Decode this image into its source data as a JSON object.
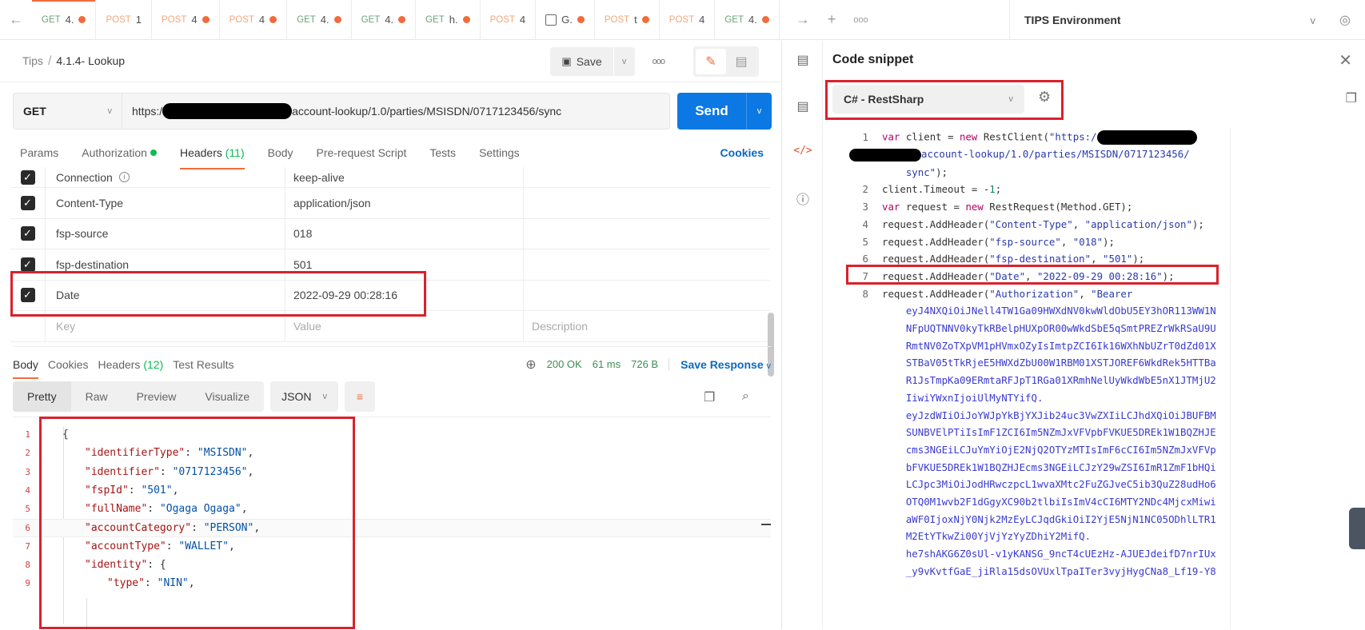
{
  "tabbar": {
    "tabs": [
      {
        "method": "GET",
        "name": "4.",
        "unsaved": true,
        "active": true
      },
      {
        "method": "POST",
        "name": "1",
        "unsaved": false
      },
      {
        "method": "POST",
        "name": "4",
        "unsaved": true
      },
      {
        "method": "POST",
        "name": "4",
        "unsaved": true
      },
      {
        "method": "GET",
        "name": "4.",
        "unsaved": true
      },
      {
        "method": "GET",
        "name": "4.",
        "unsaved": true
      },
      {
        "method": "GET",
        "name": "h.",
        "unsaved": true
      },
      {
        "method": "POST",
        "name": "4",
        "unsaved": false
      },
      {
        "method": "",
        "name": "G.",
        "unsaved": true,
        "icon": "example-icon"
      },
      {
        "method": "POST",
        "name": "t",
        "unsaved": true
      },
      {
        "method": "POST",
        "name": "4",
        "unsaved": false
      },
      {
        "method": "GET",
        "name": "4.",
        "unsaved": true
      }
    ],
    "environment": "TIPS Environment"
  },
  "request": {
    "breadcrumb_root": "Tips",
    "breadcrumb_sep": "/",
    "title": "4.1.4- Lookup",
    "save_label": "Save",
    "method": "GET",
    "url_prefix": "https:/",
    "url_suffix": "account-lookup/1.0/parties/MSISDN/0717123456/sync",
    "send_label": "Send",
    "tabs": [
      {
        "label": "Params"
      },
      {
        "label": "Authorization",
        "dot": true
      },
      {
        "label": "Headers",
        "count": "(11)",
        "active": true
      },
      {
        "label": "Body"
      },
      {
        "label": "Pre-request Script"
      },
      {
        "label": "Tests"
      },
      {
        "label": "Settings"
      }
    ],
    "cookies_label": "Cookies",
    "headers": [
      {
        "key": "Connection",
        "value": "keep-alive",
        "checked": true,
        "info": true
      },
      {
        "key": "Content-Type",
        "value": "application/json",
        "checked": true
      },
      {
        "key": "fsp-source",
        "value": "018",
        "checked": true
      },
      {
        "key": "fsp-destination",
        "value": "501",
        "checked": true
      },
      {
        "key": "Date",
        "value": "2022-09-29 00:28:16",
        "checked": true
      }
    ],
    "placeholders": {
      "key": "Key",
      "value": "Value",
      "description": "Description"
    }
  },
  "response": {
    "tabs": [
      {
        "label": "Body",
        "active": true
      },
      {
        "label": "Cookies"
      },
      {
        "label": "Headers",
        "count": "(12)"
      },
      {
        "label": "Test Results"
      }
    ],
    "status": "200 OK",
    "time": "61 ms",
    "size": "726 B",
    "save_response_label": "Save Response",
    "views": [
      "Pretty",
      "Raw",
      "Preview",
      "Visualize"
    ],
    "active_view": "Pretty",
    "format": "JSON",
    "body_lines": [
      {
        "n": "1",
        "indent": 0,
        "raw": "{"
      },
      {
        "n": "2",
        "indent": 1,
        "key": "identifierType",
        "val": "MSISDN",
        "tail": ","
      },
      {
        "n": "3",
        "indent": 1,
        "key": "identifier",
        "val": "0717123456",
        "tail": ","
      },
      {
        "n": "4",
        "indent": 1,
        "key": "fspId",
        "val": "501",
        "tail": ","
      },
      {
        "n": "5",
        "indent": 1,
        "key": "fullName",
        "val": "Ogaga Ogaga",
        "tail": ","
      },
      {
        "n": "6",
        "indent": 1,
        "key": "accountCategory",
        "val": "PERSON",
        "tail": ","
      },
      {
        "n": "7",
        "indent": 1,
        "key": "accountType",
        "val": "WALLET",
        "tail": ","
      },
      {
        "n": "8",
        "indent": 1,
        "key": "identity",
        "raw_tail": ": {"
      },
      {
        "n": "9",
        "indent": 2,
        "key": "type",
        "val": "NIN",
        "tail": ","
      }
    ]
  },
  "snippet": {
    "title": "Code snippet",
    "language": "C# - RestSharp",
    "lines": [
      {
        "n": "1",
        "parts": [
          [
            "kw",
            "var"
          ],
          [
            "pl",
            " client = "
          ],
          [
            "kw",
            "new"
          ],
          [
            "pl",
            " RestClient("
          ],
          [
            "st",
            "\"https:/"
          ]
        ],
        "redact": 1
      },
      {
        "n": "",
        "parts": [
          [
            "st",
            "account-lookup/1.0/parties/MSISDN/0717123456/"
          ]
        ],
        "redact_lead": 1
      },
      {
        "n": "",
        "parts": [
          [
            "st",
            "    sync\""
          ],
          [
            "pl",
            ");"
          ]
        ]
      },
      {
        "n": "2",
        "parts": [
          [
            "pl",
            "client.Timeout = -"
          ],
          [
            "num",
            "1"
          ],
          [
            "pl",
            ";"
          ]
        ]
      },
      {
        "n": "3",
        "parts": [
          [
            "kw",
            "var"
          ],
          [
            "pl",
            " request = "
          ],
          [
            "kw",
            "new"
          ],
          [
            "pl",
            " RestRequest(Method.GET);"
          ]
        ]
      },
      {
        "n": "4",
        "parts": [
          [
            "pl",
            "request.AddHeader("
          ],
          [
            "st",
            "\"Content-Type\""
          ],
          [
            "pl",
            ", "
          ],
          [
            "st",
            "\"application/json\""
          ],
          [
            "pl",
            ");"
          ]
        ]
      },
      {
        "n": "5",
        "parts": [
          [
            "pl",
            "request.AddHeader("
          ],
          [
            "st",
            "\"fsp-source\""
          ],
          [
            "pl",
            ", "
          ],
          [
            "st",
            "\"018\""
          ],
          [
            "pl",
            ");"
          ]
        ]
      },
      {
        "n": "6",
        "parts": [
          [
            "pl",
            "request.AddHeader("
          ],
          [
            "st",
            "\"fsp-destination\""
          ],
          [
            "pl",
            ", "
          ],
          [
            "st",
            "\"501\""
          ],
          [
            "pl",
            ");"
          ]
        ]
      },
      {
        "n": "7",
        "parts": [
          [
            "pl",
            "request.AddHeader("
          ],
          [
            "st",
            "\"Date\""
          ],
          [
            "pl",
            ", "
          ],
          [
            "st",
            "\"2022-09-29 00:28:16\""
          ],
          [
            "pl",
            ");"
          ]
        ]
      },
      {
        "n": "8",
        "parts": [
          [
            "pl",
            "request.AddHeader("
          ],
          [
            "st",
            "\"Authorization\""
          ],
          [
            "pl",
            ", "
          ],
          [
            "st",
            "\"Bearer"
          ]
        ]
      },
      {
        "n": "",
        "parts": [
          [
            "tok",
            "    eyJ4NXQiOiJNell4TW1Ga09HWXdNV0kwWldObU5EY3hOR113WW1N"
          ]
        ]
      },
      {
        "n": "",
        "parts": [
          [
            "tok",
            "    NFpUQTNNV0kyTkRBelpHUXpOR00wWkdSbE5qSmtPREZrWkRSaU9U"
          ]
        ]
      },
      {
        "n": "",
        "parts": [
          [
            "tok",
            "    RmtNV0ZoTXpVM1pHVmxOZyIsImtpZCI6Ik16WXhNbUZrT0dZd01X"
          ]
        ]
      },
      {
        "n": "",
        "parts": [
          [
            "tok",
            "    STBaV05tTkRjeE5HWXdZbU00W1RBM01XSTJOREF6WkdRek5HTTBa"
          ]
        ]
      },
      {
        "n": "",
        "parts": [
          [
            "tok",
            "    R1JsTmpKa09ERmtaRFJpT1RGa01XRmhNelUyWkdWbE5nX1JTMjU2"
          ]
        ]
      },
      {
        "n": "",
        "parts": [
          [
            "tok",
            "    IiwiYWxnIjoiUlMyNTYifQ."
          ]
        ]
      },
      {
        "n": "",
        "parts": [
          [
            "tok",
            "    eyJzdWIiOiJoYWJpYkBjYXJib24uc3VwZXIiLCJhdXQiOiJBUFBM"
          ]
        ]
      },
      {
        "n": "",
        "parts": [
          [
            "tok",
            "    SUNBVElPTiIsImF1ZCI6Im5NZmJxVFVpbFVKUE5DREk1W1BQZHJE"
          ]
        ]
      },
      {
        "n": "",
        "parts": [
          [
            "tok",
            "    cms3NGEiLCJuYmYiOjE2NjQ2OTYzMTIsImF6cCI6Im5NZmJxVFVp"
          ]
        ]
      },
      {
        "n": "",
        "parts": [
          [
            "tok",
            "    bFVKUE5DREk1W1BQZHJEcms3NGEiLCJzY29wZSI6ImR1ZmF1bHQi"
          ]
        ]
      },
      {
        "n": "",
        "parts": [
          [
            "tok",
            "    LCJpc3MiOiJodHRwczpcL1wvaXMtc2FuZGJveC5ib3QuZ28udHo6"
          ]
        ]
      },
      {
        "n": "",
        "parts": [
          [
            "tok",
            "    OTQ0M1wvb2F1dGgyXC90b2tlbiIsImV4cCI6MTY2NDc4MjcxMiwi"
          ]
        ]
      },
      {
        "n": "",
        "parts": [
          [
            "tok",
            "    aWF0IjoxNjY0Njk2MzEyLCJqdGkiOiI2YjE5NjN1NC05ODhlLTR1"
          ]
        ]
      },
      {
        "n": "",
        "parts": [
          [
            "tok",
            "    M2EtYTkwZi00YjVjYzYyZDhiY2MifQ."
          ]
        ]
      },
      {
        "n": "",
        "parts": [
          [
            "tok",
            "    he7shAKG6Z0sUl-v1yKANSG_9ncT4cUEzHz-AJUEJdeifD7nrIUx"
          ]
        ]
      },
      {
        "n": "",
        "parts": [
          [
            "tok",
            "    _y9vKvtfGaE_jiRla15dsOVUxlTpaITer3vyjHygCNa8_Lf19-Y8"
          ]
        ]
      }
    ]
  },
  "icons": {
    "back": "←",
    "forward": "→",
    "plus": "+",
    "more": "ooo",
    "chevron": "⌄",
    "eye": "◎",
    "save": "🖫",
    "pencil": "✎",
    "comment": "▤",
    "close": "✕",
    "gear": "⚙",
    "copy": "❐",
    "search": "⌕",
    "globe": "🌐",
    "check": "✓",
    "doc": "▯",
    "code": "</>",
    "info": "ⓘ",
    "wrap": "≡"
  }
}
